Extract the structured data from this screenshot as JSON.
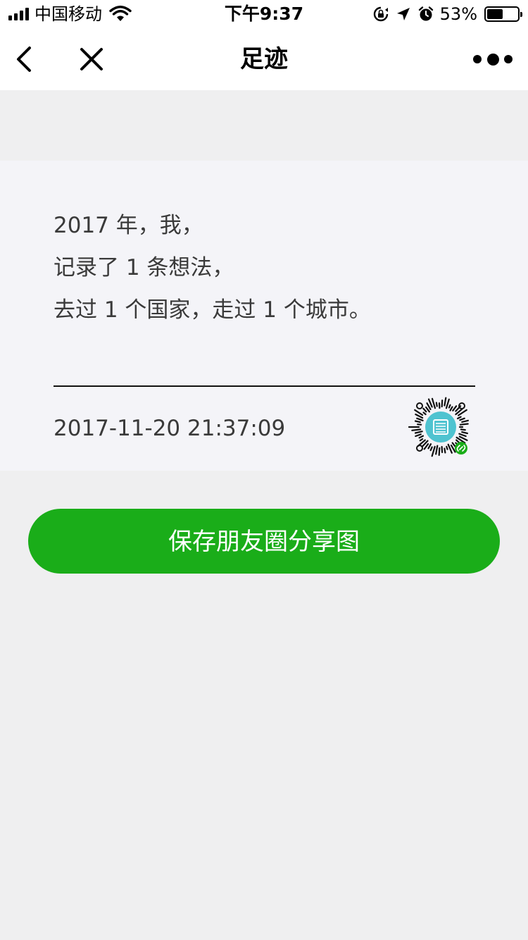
{
  "status_bar": {
    "carrier": "中国移动",
    "time": "下午9:37",
    "battery_percent_label": "53%",
    "battery_level": 0.53
  },
  "nav": {
    "title": "足迹",
    "back_icon": "chevron-left-icon",
    "close_icon": "close-icon",
    "more_icon": "more-dots-icon"
  },
  "card": {
    "lines": [
      "2017 年，我，",
      "记录了 1 条想法，",
      "去过 1 个国家，走过 1 个城市。"
    ],
    "timestamp": "2017-11-20 21:37:09",
    "qr_icon": "mini-program-code-icon"
  },
  "save_button": {
    "label": "保存朋友圈分享图"
  },
  "colors": {
    "accent": "#1aad19",
    "page_bg": "#efeff0",
    "card_bg": "#f4f4f8",
    "qr_center": "#4fc3d0"
  }
}
